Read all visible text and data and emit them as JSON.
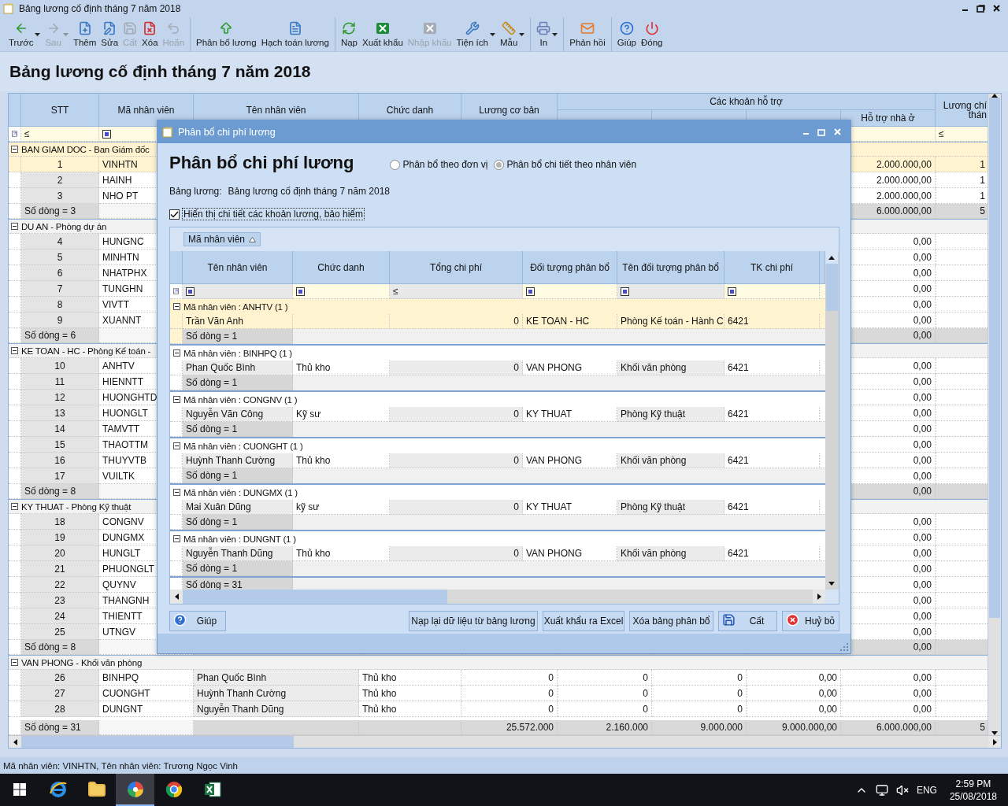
{
  "window": {
    "title": "Bảng lương cố định tháng 7 năm 2018"
  },
  "toolbar": [
    [
      {
        "label": "Trước",
        "disabled": false,
        "dropdown": true
      },
      {
        "label": "Sau",
        "disabled": true,
        "dropdown": true
      },
      {
        "label": "Thêm",
        "disabled": false,
        "dropdown": false
      },
      {
        "label": "Sửa",
        "disabled": false,
        "dropdown": false
      },
      {
        "label": "Cất",
        "disabled": true,
        "dropdown": false
      },
      {
        "label": "Xóa",
        "disabled": false,
        "dropdown": false
      },
      {
        "label": "Hoãn",
        "disabled": true,
        "dropdown": false
      }
    ],
    [
      {
        "label": "Phân bổ lương",
        "disabled": false,
        "dropdown": false
      },
      {
        "label": "Hạch toán lương",
        "disabled": false,
        "dropdown": false
      }
    ],
    [
      {
        "label": "Nạp",
        "disabled": false,
        "dropdown": false
      },
      {
        "label": "Xuất khẩu",
        "disabled": false,
        "dropdown": false
      },
      {
        "label": "Nhập khẩu",
        "disabled": true,
        "dropdown": false
      },
      {
        "label": "Tiện ích",
        "disabled": false,
        "dropdown": true
      },
      {
        "label": "Mẫu",
        "disabled": false,
        "dropdown": true
      }
    ],
    [
      {
        "label": "In",
        "disabled": false,
        "dropdown": true
      }
    ],
    [
      {
        "label": "Phản hồi",
        "disabled": false,
        "dropdown": false
      }
    ],
    [
      {
        "label": "Giúp",
        "disabled": false,
        "dropdown": false
      },
      {
        "label": "Đóng",
        "disabled": false,
        "dropdown": false
      }
    ]
  ],
  "page_title": "Bảng lương cố định tháng 7 năm 2018",
  "table": {
    "head_left": [
      "STT",
      "Mã nhân viên",
      "Tên nhân viên",
      "Chức danh",
      "Lương cơ bản"
    ],
    "band": {
      "label": "Các khoản hỗ trợ",
      "columns": [
        "Hỗ trợ nhà ở"
      ]
    },
    "head_right": [
      "Lương chí thán"
    ],
    "filters": [
      {
        "kind": "compare",
        "symbol": "≤"
      },
      {
        "kind": "box"
      },
      {
        "kind": "blank"
      },
      {
        "kind": "blank"
      },
      {
        "kind": "blank"
      },
      {
        "kind": "blank"
      },
      {
        "kind": "blank"
      },
      {
        "kind": "blank"
      },
      {
        "kind": "blank"
      },
      {
        "kind": "compare",
        "symbol": "≤"
      }
    ],
    "groups": [
      {
        "label": "BAN GIAM DOC - Ban Giám đốc",
        "selected": true,
        "rows": [
          {
            "stt": "1",
            "code": "VINHTN",
            "housing": "2.000.000,00",
            "main": "1",
            "selected": true
          },
          {
            "stt": "2",
            "code": "HAINH",
            "housing": "2.000.000,00",
            "main": "1",
            "selected": false
          },
          {
            "stt": "3",
            "code": "NHO PT",
            "housing": "2.000.000,00",
            "main": "1",
            "selected": false
          }
        ],
        "summary": {
          "stt": "Số dòng = 3",
          "housing": "6.000.000,00",
          "main": "5"
        }
      },
      {
        "label": "DU AN - Phòng dự án",
        "selected": false,
        "rows": [
          {
            "stt": "4",
            "code": "HUNGNC",
            "housing": "0,00",
            "selected": false
          },
          {
            "stt": "5",
            "code": "MINHTN",
            "housing": "0,00",
            "selected": false
          },
          {
            "stt": "6",
            "code": "NHATPHX",
            "housing": "0,00",
            "selected": false
          },
          {
            "stt": "7",
            "code": "TUNGHN",
            "housing": "0,00",
            "selected": false
          },
          {
            "stt": "8",
            "code": "VIVTT",
            "housing": "0,00",
            "selected": false
          },
          {
            "stt": "9",
            "code": "XUANNT",
            "housing": "0,00",
            "selected": false
          }
        ],
        "summary": {
          "stt": "Số dòng = 6",
          "housing": "0,00"
        }
      },
      {
        "label": "KE TOAN - HC - Phòng Kế toán -",
        "selected": false,
        "rows": [
          {
            "stt": "10",
            "code": "ANHTV",
            "housing": "0,00",
            "selected": false
          },
          {
            "stt": "11",
            "code": "HIENNTT",
            "housing": "0,00",
            "selected": false
          },
          {
            "stt": "12",
            "code": "HUONGHTD",
            "housing": "0,00",
            "selected": false
          },
          {
            "stt": "13",
            "code": "HUONGLT",
            "housing": "0,00",
            "selected": false
          },
          {
            "stt": "14",
            "code": "TAMVTT",
            "housing": "0,00",
            "selected": false
          },
          {
            "stt": "15",
            "code": "THAOTTM",
            "housing": "0,00",
            "selected": false
          },
          {
            "stt": "16",
            "code": "THUYVTB",
            "housing": "0,00",
            "selected": false
          },
          {
            "stt": "17",
            "code": "VUILTK",
            "housing": "0,00",
            "selected": false
          }
        ],
        "summary": {
          "stt": "Số dòng = 8",
          "housing": "0,00"
        }
      },
      {
        "label": "KY THUAT - Phòng Kỹ thuật",
        "selected": false,
        "rows": [
          {
            "stt": "18",
            "code": "CONGNV",
            "housing": "0,00",
            "selected": false
          },
          {
            "stt": "19",
            "code": "DUNGMX",
            "housing": "0,00",
            "selected": false
          },
          {
            "stt": "20",
            "code": "HUNGLT",
            "housing": "0,00",
            "selected": false
          },
          {
            "stt": "21",
            "code": "PHUONGLT",
            "housing": "0,00",
            "selected": false
          },
          {
            "stt": "22",
            "code": "QUYNV",
            "housing": "0,00",
            "selected": false
          },
          {
            "stt": "23",
            "code": "THANGNH",
            "housing": "0,00",
            "selected": false
          },
          {
            "stt": "24",
            "code": "THIENTT",
            "housing": "0,00",
            "selected": false
          },
          {
            "stt": "25",
            "code": "UTNGV",
            "housing": "0,00",
            "selected": false
          }
        ],
        "summary": {
          "stt": "Số dòng = 8",
          "housing": "0,00"
        }
      },
      {
        "label": "VAN PHONG - Khối văn phòng",
        "selected": false,
        "rows": [
          {
            "stt": "26",
            "code": "BINHPQ",
            "name": "Phan Quốc Bình",
            "title": "Thủ kho",
            "base": "0",
            "lunch": "0",
            "fuel": "0",
            "phone": "0,00",
            "housing": "0,00",
            "selected": false
          },
          {
            "stt": "27",
            "code": "CUONGHT",
            "name": "Huỳnh Thanh Cường",
            "title": "Thủ kho",
            "base": "0",
            "lunch": "0",
            "fuel": "0",
            "phone": "0,00",
            "housing": "0,00",
            "selected": false
          },
          {
            "stt": "28",
            "code": "DUNGNT",
            "name": "Nguyễn Thanh Dũng",
            "title": "Thủ kho",
            "base": "0",
            "lunch": "0",
            "fuel": "0",
            "phone": "0,00",
            "housing": "0,00",
            "selected": false
          }
        ]
      }
    ],
    "footer": {
      "stt": "Số dòng = 31",
      "base": "25.572.000",
      "lunch": "2.160.000",
      "fuel": "9.000.000",
      "phone": "9.000.000,00",
      "housing": "6.000.000,00",
      "main": "5"
    }
  },
  "dialog": {
    "title": "Phân bổ chi phí lương",
    "heading": "Phân bổ chi phí lương",
    "modes": [
      {
        "label": "Phân bổ theo đơn vị",
        "selected": false
      },
      {
        "label": "Phân bổ chi tiết theo nhân viên",
        "selected": true
      }
    ],
    "payroll_label": "Bảng lương:",
    "payroll_value": "Bảng lương cố định tháng 7 năm 2018",
    "show_details": {
      "label": "Hiển thị chi tiết các khoản lương, bảo hiểm",
      "checked": true
    },
    "grid": {
      "group_by": "Mã nhân viên",
      "columns": [
        {
          "label": "Tên nhân viên",
          "readonly": true,
          "filter": {
            "kind": "box"
          }
        },
        {
          "label": "Chức danh",
          "readonly": false,
          "filter": {
            "kind": "box"
          }
        },
        {
          "label": "Tổng chi phí",
          "readonly": true,
          "filter": {
            "kind": "compare",
            "symbol": "≤"
          }
        },
        {
          "label": "Đối tượng phân bổ",
          "readonly": false,
          "filter": {
            "kind": "box"
          }
        },
        {
          "label": "Tên đối tượng phân bổ",
          "readonly": true,
          "filter": {
            "kind": "box"
          }
        },
        {
          "label": "TK chi phí",
          "readonly": false,
          "filter": {
            "kind": "box"
          }
        }
      ],
      "groups": [
        {
          "label": "Mã nhân viên : ANHTV (1 )",
          "selected": true,
          "row": {
            "name": "Trần Văn Anh",
            "total": "0",
            "target": "KE TOAN - HC",
            "target_name": "Phòng  Kế toán - Hành C",
            "account": "6421"
          },
          "summary": "Số dòng = 1"
        },
        {
          "label": "Mã nhân viên : BINHPQ (1 )",
          "selected": false,
          "row": {
            "name": "Phan Quốc Bình",
            "title": "Thủ kho",
            "total": "0",
            "target": "VAN PHONG",
            "target_name": "Khối văn phòng",
            "account": "6421"
          },
          "summary": "Số dòng = 1"
        },
        {
          "label": "Mã nhân viên : CONGNV (1 )",
          "selected": false,
          "row": {
            "name": "Nguyễn Văn Công",
            "title": "Kỹ sư",
            "total": "0",
            "target": "KY THUAT",
            "target_name": "Phòng Kỹ thuật",
            "account": "6421"
          },
          "summary": "Số dòng = 1"
        },
        {
          "label": "Mã nhân viên : CUONGHT (1 )",
          "selected": false,
          "row": {
            "name": "Huỳnh Thanh Cường",
            "title": "Thủ kho",
            "total": "0",
            "target": "VAN PHONG",
            "target_name": "Khối văn phòng",
            "account": "6421"
          },
          "summary": "Số dòng = 1"
        },
        {
          "label": "Mã nhân viên : DUNGMX (1 )",
          "selected": false,
          "row": {
            "name": "Mai Xuân Dũng",
            "title": "kỹ sư",
            "total": "0",
            "target": "KY THUAT",
            "target_name": "Phòng Kỹ thuật",
            "account": "6421"
          },
          "summary": "Số dòng = 1"
        },
        {
          "label": "Mã nhân viên : DUNGNT (1 )",
          "selected": false,
          "row": {
            "name": "Nguyễn Thanh Dũng",
            "title": "Thủ kho",
            "total": "0",
            "target": "VAN PHONG",
            "target_name": "Khối văn phòng",
            "account": "6421"
          },
          "summary": "Số dòng = 1"
        }
      ],
      "total": "Số dòng = 31"
    },
    "buttons": [
      {
        "label": "Giúp"
      },
      {
        "label": "Nạp lại dữ liệu từ bảng lương"
      },
      {
        "label": "Xuất khẩu ra Excel"
      },
      {
        "label": "Xóa bảng phân bổ"
      },
      {
        "label": "Cất"
      },
      {
        "label": "Huỷ bỏ"
      }
    ]
  },
  "status_bar": "Mã nhân viên: VINHTN, Tên nhân viên: Trương Ngọc Vinh",
  "taskbar": {
    "apps": [
      {
        "selected": false
      },
      {
        "selected": false
      },
      {
        "selected": true
      },
      {
        "selected": false
      },
      {
        "selected": false
      }
    ],
    "language": "ENG",
    "time": "2:59 PM",
    "date": "25/08/2018"
  }
}
